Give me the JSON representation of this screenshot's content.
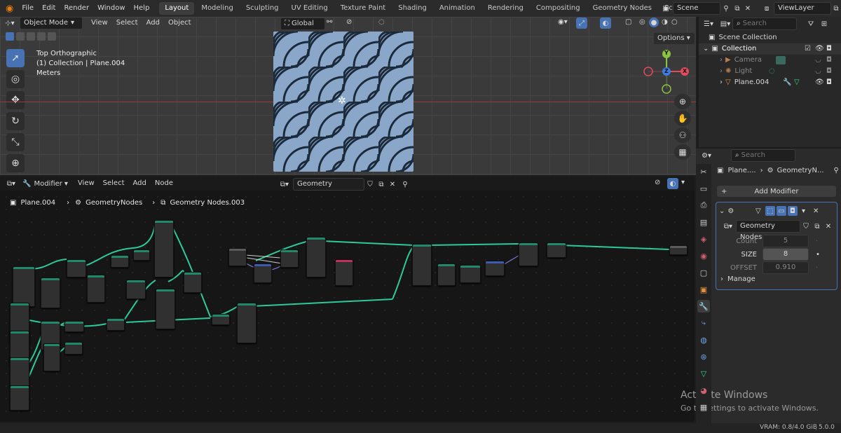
{
  "topbar": {
    "menus": [
      "File",
      "Edit",
      "Render",
      "Window",
      "Help"
    ],
    "workspaces": [
      "Layout",
      "Modeling",
      "Sculpting",
      "UV Editing",
      "Texture Paint",
      "Shading",
      "Animation",
      "Rendering",
      "Compositing",
      "Geometry Nodes",
      "Scripting"
    ],
    "active_workspace": "Layout",
    "add_tab": "+",
    "scene": "Scene",
    "view_layer": "ViewLayer"
  },
  "viewport": {
    "mode": "Object Mode",
    "menus": [
      "View",
      "Select",
      "Add",
      "Object"
    ],
    "orientation": "Global",
    "options_label": "Options",
    "overlay_title": "Top Orthographic",
    "overlay_collection": "(1) Collection | Plane.004",
    "overlay_units": "Meters",
    "gizmo": {
      "y": "Y",
      "z": "Z",
      "x": "X"
    }
  },
  "outliner": {
    "search_placeholder": "Search",
    "scene_collection": "Scene Collection",
    "collection": "Collection",
    "items": [
      "Camera",
      "Light",
      "Plane.004"
    ]
  },
  "node_editor": {
    "editor_type": "Modifier",
    "menus": [
      "View",
      "Select",
      "Add",
      "Node"
    ],
    "node_group": "Geometry Nodes.003",
    "breadcrumb": [
      "Plane.004",
      "GeometryNodes",
      "Geometry Nodes.003"
    ]
  },
  "properties": {
    "search_placeholder": "Search",
    "object": "Plane....",
    "modifier": "GeometryN...",
    "add_modifier": "Add Modifier",
    "node_group": "Geometry Nodes...",
    "fields": [
      {
        "label": "Count",
        "value": "5"
      },
      {
        "label": "SIZE",
        "value": "8"
      },
      {
        "label": "OFFSET",
        "value": "0.910"
      }
    ],
    "manage": "Manage"
  },
  "watermark": {
    "title": "Activate Windows",
    "subtitle": "Go to Settings to activate Windows."
  },
  "status": {
    "vram": "VRAM: 0.8/4.0 GiB",
    "version": "5.0.0"
  },
  "colors": {
    "accent": "#4772b3",
    "wire": "#2ec99a",
    "header_bg": "#2b2b2b"
  }
}
